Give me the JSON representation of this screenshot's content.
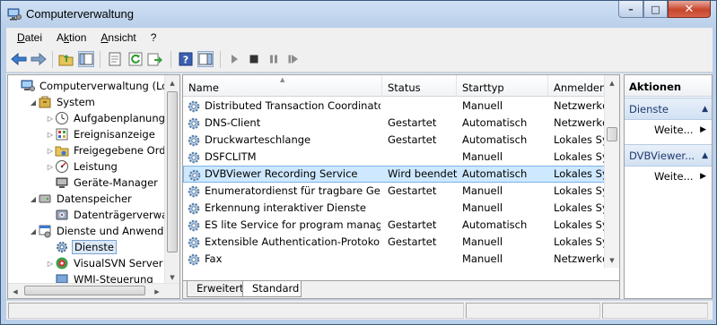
{
  "window": {
    "title": "Computerverwaltung",
    "minimize_glyph": "–",
    "maximize_glyph": "□",
    "close_glyph": "✕"
  },
  "menu": [
    {
      "label": "Datei"
    },
    {
      "label": "Aktion"
    },
    {
      "label": "Ansicht"
    },
    {
      "label": "?"
    }
  ],
  "toolbar": {
    "icons": [
      "back-icon",
      "forward-icon",
      "up-folder-icon",
      "show-hide-tree-icon",
      "properties-icon",
      "refresh-icon",
      "export-icon",
      "help-icon",
      "show-action-pane-icon",
      "start-service-icon",
      "stop-service-icon",
      "pause-service-icon",
      "restart-service-icon"
    ]
  },
  "tree": {
    "items": [
      {
        "label": "Computerverwaltung (Loka",
        "level": 0,
        "expander": "",
        "icon": "computer-management-icon"
      },
      {
        "label": "System",
        "level": 1,
        "expander": "◢",
        "icon": "system-tools-icon"
      },
      {
        "label": "Aufgabenplanung",
        "level": 2,
        "expander": "▷",
        "icon": "clock-icon"
      },
      {
        "label": "Ereignisanzeige",
        "level": 2,
        "expander": "▷",
        "icon": "event-viewer-icon"
      },
      {
        "label": "Freigegebene Ordne",
        "level": 2,
        "expander": "▷",
        "icon": "shared-folder-icon"
      },
      {
        "label": "Leistung",
        "level": 2,
        "expander": "▷",
        "icon": "performance-icon"
      },
      {
        "label": "Geräte-Manager",
        "level": 2,
        "expander": "",
        "icon": "device-manager-icon"
      },
      {
        "label": "Datenspeicher",
        "level": 1,
        "expander": "◢",
        "icon": "storage-icon"
      },
      {
        "label": "Datenträgerverwaltu",
        "level": 2,
        "expander": "",
        "icon": "disk-management-icon"
      },
      {
        "label": "Dienste und Anwendung",
        "level": 1,
        "expander": "◢",
        "icon": "services-apps-icon"
      },
      {
        "label": "Dienste",
        "level": 2,
        "expander": "",
        "icon": "services-gear-icon",
        "selected": true
      },
      {
        "label": "VisualSVN Server",
        "level": 2,
        "expander": "▷",
        "icon": "visualsvn-icon"
      },
      {
        "label": "WMI-Steuerung",
        "level": 2,
        "expander": "",
        "icon": "wmi-icon"
      }
    ]
  },
  "list": {
    "sort_glyph": "▲",
    "columns": [
      "Name",
      "Status",
      "Starttyp",
      "Anmelden"
    ],
    "rows": [
      {
        "name": "Distributed Transaction Coordinator",
        "status": "",
        "starttype": "Manuell",
        "logon": "Netzwerkd"
      },
      {
        "name": "DNS-Client",
        "status": "Gestartet",
        "starttype": "Automatisch",
        "logon": "Netzwerkd"
      },
      {
        "name": "Druckwarteschlange",
        "status": "Gestartet",
        "starttype": "Automatisch",
        "logon": "Lokales Sy"
      },
      {
        "name": "DSFCLITM",
        "status": "",
        "starttype": "Manuell",
        "logon": "Lokales Sy"
      },
      {
        "name": "DVBViewer Recording Service",
        "status": "Wird beendet",
        "starttype": "Automatisch",
        "logon": "Lokales Sy",
        "selected": true
      },
      {
        "name": "Enumeratordienst für tragbare Geräte",
        "status": "Gestartet",
        "starttype": "Manuell",
        "logon": "Lokales Sy"
      },
      {
        "name": "Erkennung interaktiver Dienste",
        "status": "",
        "starttype": "Manuell",
        "logon": "Lokales Sy"
      },
      {
        "name": "ES lite Service for program manage...",
        "status": "Gestartet",
        "starttype": "Automatisch",
        "logon": "Lokales Sy"
      },
      {
        "name": "Extensible Authentication-Protokoll",
        "status": "Gestartet",
        "starttype": "Manuell",
        "logon": "Lokales Sy"
      },
      {
        "name": "Fax",
        "status": "",
        "starttype": "Manuell",
        "logon": "Netzwerkd"
      }
    ],
    "tabs": [
      "Erweitert",
      "Standard"
    ],
    "active_tab": "Standard"
  },
  "actions": {
    "header": "Aktionen",
    "sections": [
      {
        "title": "Dienste",
        "items": [
          "Weite..."
        ]
      },
      {
        "title": "DVBViewer...",
        "items": [
          "Weite..."
        ]
      }
    ],
    "collapse_glyph": "▲",
    "item_arrow_glyph": "▶"
  },
  "colors": {
    "selection_row": "#cde8ff",
    "selection_border": "#7eb4ea",
    "action_section": "#dce8f6",
    "titlebar": "#b9cfe9"
  }
}
